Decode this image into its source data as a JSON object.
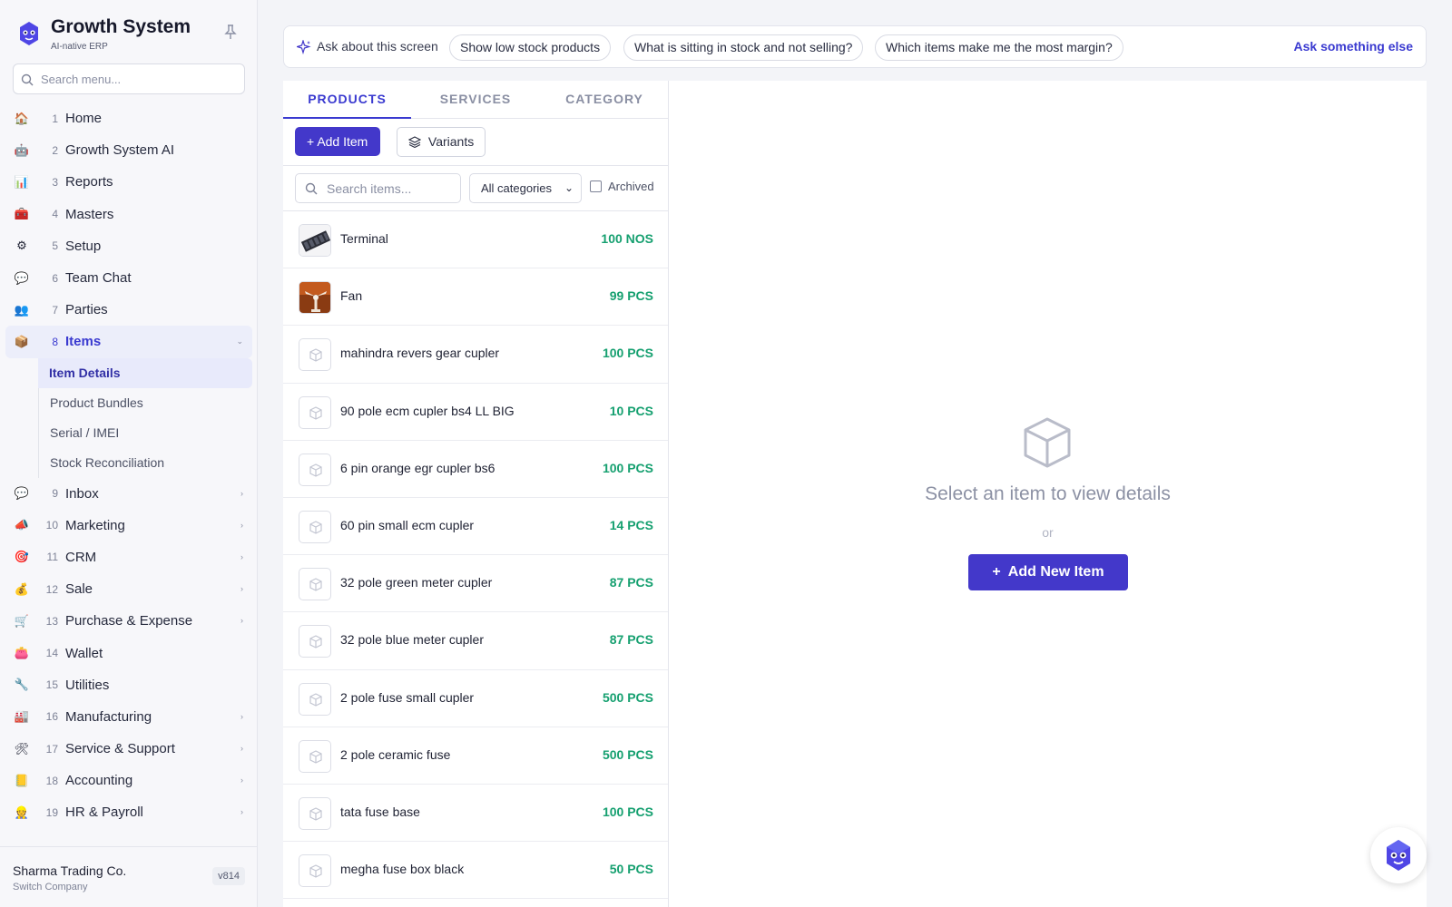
{
  "brand": {
    "title": "Growth System",
    "subtitle": "AI-native ERP"
  },
  "sidebar_search": {
    "placeholder": "Search menu..."
  },
  "nav": [
    {
      "num": "1",
      "label": "Home",
      "icon": "home-icon",
      "glyph": "🏠"
    },
    {
      "num": "2",
      "label": "Growth System AI",
      "icon": "robot-icon",
      "glyph": "🤖"
    },
    {
      "num": "3",
      "label": "Reports",
      "icon": "chart-icon",
      "glyph": "📊"
    },
    {
      "num": "4",
      "label": "Masters",
      "icon": "toolbox-icon",
      "glyph": "🧰"
    },
    {
      "num": "5",
      "label": "Setup",
      "icon": "gear-icon",
      "glyph": "⚙"
    },
    {
      "num": "6",
      "label": "Team Chat",
      "icon": "chat-icon",
      "glyph": "💬"
    },
    {
      "num": "7",
      "label": "Parties",
      "icon": "people-icon",
      "glyph": "👥"
    },
    {
      "num": "8",
      "label": "Items",
      "icon": "package-icon",
      "glyph": "📦"
    },
    {
      "num": "9",
      "label": "Inbox",
      "icon": "inbox-chat-icon",
      "glyph": "💬"
    },
    {
      "num": "10",
      "label": "Marketing",
      "icon": "megaphone-icon",
      "glyph": "📣"
    },
    {
      "num": "11",
      "label": "CRM",
      "icon": "target-icon",
      "glyph": "🎯"
    },
    {
      "num": "12",
      "label": "Sale",
      "icon": "money-bag-icon",
      "glyph": "💰"
    },
    {
      "num": "13",
      "label": "Purchase & Expense",
      "icon": "cart-icon",
      "glyph": "🛒"
    },
    {
      "num": "14",
      "label": "Wallet",
      "icon": "purse-icon",
      "glyph": "👛"
    },
    {
      "num": "15",
      "label": "Utilities",
      "icon": "wrench-icon",
      "glyph": "🔧"
    },
    {
      "num": "16",
      "label": "Manufacturing",
      "icon": "factory-icon",
      "glyph": "🏭"
    },
    {
      "num": "17",
      "label": "Service & Support",
      "icon": "tools-icon",
      "glyph": "🛠"
    },
    {
      "num": "18",
      "label": "Accounting",
      "icon": "ledger-icon",
      "glyph": "📒"
    },
    {
      "num": "19",
      "label": "HR & Payroll",
      "icon": "worker-icon",
      "glyph": "👷"
    }
  ],
  "items_submenu": [
    "Item Details",
    "Product Bundles",
    "Serial / IMEI",
    "Stock Reconciliation"
  ],
  "company": {
    "name": "Sharma Trading Co.",
    "switch": "Switch Company",
    "version": "v814"
  },
  "ai_bar": {
    "ask": "Ask about this screen",
    "chips": [
      "Show low stock products",
      "What is sitting in stock and not selling?",
      "Which items make me the most margin?"
    ],
    "more": "Ask something else"
  },
  "tabs": [
    "PRODUCTS",
    "SERVICES",
    "CATEGORY"
  ],
  "toolbar": {
    "add": "Add Item",
    "variants": "Variants"
  },
  "filters": {
    "search_placeholder": "Search items...",
    "category": "All categories",
    "archived": "Archived"
  },
  "items": [
    {
      "name": "Terminal",
      "qty": "100 NOS",
      "thumb": "terminal-photo"
    },
    {
      "name": "Fan",
      "qty": "99 PCS",
      "thumb": "fan-photo"
    },
    {
      "name": "mahindra revers gear cupler",
      "qty": "100 PCS",
      "thumb": "box-icon"
    },
    {
      "name": "90 pole ecm cupler bs4 LL BIG",
      "qty": "10 PCS",
      "thumb": "box-icon"
    },
    {
      "name": "6 pin orange egr cupler bs6",
      "qty": "100 PCS",
      "thumb": "box-icon"
    },
    {
      "name": "60 pin small ecm cupler",
      "qty": "14 PCS",
      "thumb": "box-icon"
    },
    {
      "name": "32 pole green meter cupler",
      "qty": "87 PCS",
      "thumb": "box-icon"
    },
    {
      "name": "32 pole blue meter cupler",
      "qty": "87 PCS",
      "thumb": "box-icon"
    },
    {
      "name": "2 pole fuse small cupler",
      "qty": "500 PCS",
      "thumb": "box-icon"
    },
    {
      "name": "2 pole ceramic fuse",
      "qty": "500 PCS",
      "thumb": "box-icon"
    },
    {
      "name": "tata fuse base",
      "qty": "100 PCS",
      "thumb": "box-icon"
    },
    {
      "name": "megha fuse box black",
      "qty": "50 PCS",
      "thumb": "box-icon"
    }
  ],
  "details": {
    "empty": "Select an item to view details",
    "or": "or",
    "add_new": "Add New Item"
  },
  "colors": {
    "accent": "#4338ca",
    "stock": "#16a070"
  }
}
